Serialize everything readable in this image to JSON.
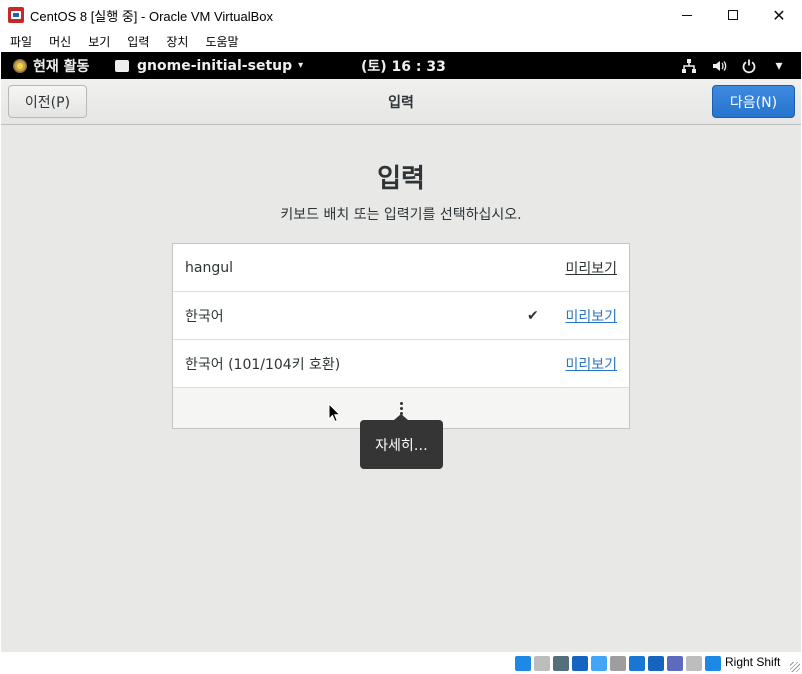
{
  "window": {
    "title": "CentOS 8 [실행 중] - Oracle VM VirtualBox",
    "icon": "virtualbox-icon",
    "controls": {
      "minimize": "minimize-icon",
      "maximize": "maximize-icon",
      "close": "✕"
    }
  },
  "vbox_menu": [
    "파일",
    "머신",
    "보기",
    "입력",
    "장치",
    "도움말"
  ],
  "gnome_topbar": {
    "activities": "현재 활동",
    "app_name": "gnome-initial-setup",
    "app_arrow": "▾",
    "clock": "(토) 16 : 33",
    "tray": {
      "network": "network-icon",
      "volume": "volume-icon",
      "power": "power-icon",
      "arrow": "▾"
    }
  },
  "headerbar": {
    "prev_label": "이전(P)",
    "title": "입력",
    "next_label": "다음(N)"
  },
  "content": {
    "heading": "입력",
    "subtitle": "키보드 배치 또는 입력기를 선택하십시오.",
    "rows": [
      {
        "label": "hangul",
        "preview": "미리보기",
        "selected": false
      },
      {
        "label": "한국어",
        "preview": "미리보기",
        "selected": true,
        "check": "✔"
      },
      {
        "label": "한국어 (101/104키 호환)",
        "preview": "미리보기",
        "selected": false
      }
    ],
    "more_tooltip": "자세히…"
  },
  "statusbar": {
    "host_key": "Right Shift",
    "icon_colors": [
      "#1e88e5",
      "#bdbdbd",
      "#546e7a",
      "#1565c0",
      "#42a5f5",
      "#9e9e9e",
      "#1976d2",
      "#1565c0",
      "#5c6bc0",
      "#bdbdbd",
      "#1e88e5"
    ]
  },
  "colors": {
    "accent": "#2a76c6",
    "next_button": "#2774cc",
    "topbar": "#000000",
    "tooltip": "#353535"
  }
}
